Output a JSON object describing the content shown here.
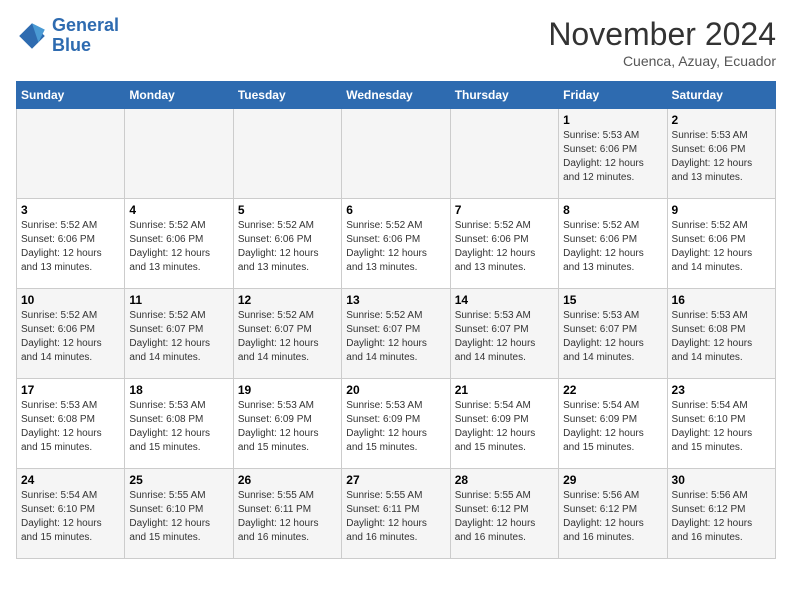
{
  "header": {
    "logo_line1": "General",
    "logo_line2": "Blue",
    "month": "November 2024",
    "location": "Cuenca, Azuay, Ecuador"
  },
  "days_of_week": [
    "Sunday",
    "Monday",
    "Tuesday",
    "Wednesday",
    "Thursday",
    "Friday",
    "Saturday"
  ],
  "weeks": [
    [
      {
        "day": "",
        "info": ""
      },
      {
        "day": "",
        "info": ""
      },
      {
        "day": "",
        "info": ""
      },
      {
        "day": "",
        "info": ""
      },
      {
        "day": "",
        "info": ""
      },
      {
        "day": "1",
        "info": "Sunrise: 5:53 AM\nSunset: 6:06 PM\nDaylight: 12 hours\nand 12 minutes."
      },
      {
        "day": "2",
        "info": "Sunrise: 5:53 AM\nSunset: 6:06 PM\nDaylight: 12 hours\nand 13 minutes."
      }
    ],
    [
      {
        "day": "3",
        "info": "Sunrise: 5:52 AM\nSunset: 6:06 PM\nDaylight: 12 hours\nand 13 minutes."
      },
      {
        "day": "4",
        "info": "Sunrise: 5:52 AM\nSunset: 6:06 PM\nDaylight: 12 hours\nand 13 minutes."
      },
      {
        "day": "5",
        "info": "Sunrise: 5:52 AM\nSunset: 6:06 PM\nDaylight: 12 hours\nand 13 minutes."
      },
      {
        "day": "6",
        "info": "Sunrise: 5:52 AM\nSunset: 6:06 PM\nDaylight: 12 hours\nand 13 minutes."
      },
      {
        "day": "7",
        "info": "Sunrise: 5:52 AM\nSunset: 6:06 PM\nDaylight: 12 hours\nand 13 minutes."
      },
      {
        "day": "8",
        "info": "Sunrise: 5:52 AM\nSunset: 6:06 PM\nDaylight: 12 hours\nand 13 minutes."
      },
      {
        "day": "9",
        "info": "Sunrise: 5:52 AM\nSunset: 6:06 PM\nDaylight: 12 hours\nand 14 minutes."
      }
    ],
    [
      {
        "day": "10",
        "info": "Sunrise: 5:52 AM\nSunset: 6:06 PM\nDaylight: 12 hours\nand 14 minutes."
      },
      {
        "day": "11",
        "info": "Sunrise: 5:52 AM\nSunset: 6:07 PM\nDaylight: 12 hours\nand 14 minutes."
      },
      {
        "day": "12",
        "info": "Sunrise: 5:52 AM\nSunset: 6:07 PM\nDaylight: 12 hours\nand 14 minutes."
      },
      {
        "day": "13",
        "info": "Sunrise: 5:52 AM\nSunset: 6:07 PM\nDaylight: 12 hours\nand 14 minutes."
      },
      {
        "day": "14",
        "info": "Sunrise: 5:53 AM\nSunset: 6:07 PM\nDaylight: 12 hours\nand 14 minutes."
      },
      {
        "day": "15",
        "info": "Sunrise: 5:53 AM\nSunset: 6:07 PM\nDaylight: 12 hours\nand 14 minutes."
      },
      {
        "day": "16",
        "info": "Sunrise: 5:53 AM\nSunset: 6:08 PM\nDaylight: 12 hours\nand 14 minutes."
      }
    ],
    [
      {
        "day": "17",
        "info": "Sunrise: 5:53 AM\nSunset: 6:08 PM\nDaylight: 12 hours\nand 15 minutes."
      },
      {
        "day": "18",
        "info": "Sunrise: 5:53 AM\nSunset: 6:08 PM\nDaylight: 12 hours\nand 15 minutes."
      },
      {
        "day": "19",
        "info": "Sunrise: 5:53 AM\nSunset: 6:09 PM\nDaylight: 12 hours\nand 15 minutes."
      },
      {
        "day": "20",
        "info": "Sunrise: 5:53 AM\nSunset: 6:09 PM\nDaylight: 12 hours\nand 15 minutes."
      },
      {
        "day": "21",
        "info": "Sunrise: 5:54 AM\nSunset: 6:09 PM\nDaylight: 12 hours\nand 15 minutes."
      },
      {
        "day": "22",
        "info": "Sunrise: 5:54 AM\nSunset: 6:09 PM\nDaylight: 12 hours\nand 15 minutes."
      },
      {
        "day": "23",
        "info": "Sunrise: 5:54 AM\nSunset: 6:10 PM\nDaylight: 12 hours\nand 15 minutes."
      }
    ],
    [
      {
        "day": "24",
        "info": "Sunrise: 5:54 AM\nSunset: 6:10 PM\nDaylight: 12 hours\nand 15 minutes."
      },
      {
        "day": "25",
        "info": "Sunrise: 5:55 AM\nSunset: 6:10 PM\nDaylight: 12 hours\nand 15 minutes."
      },
      {
        "day": "26",
        "info": "Sunrise: 5:55 AM\nSunset: 6:11 PM\nDaylight: 12 hours\nand 16 minutes."
      },
      {
        "day": "27",
        "info": "Sunrise: 5:55 AM\nSunset: 6:11 PM\nDaylight: 12 hours\nand 16 minutes."
      },
      {
        "day": "28",
        "info": "Sunrise: 5:55 AM\nSunset: 6:12 PM\nDaylight: 12 hours\nand 16 minutes."
      },
      {
        "day": "29",
        "info": "Sunrise: 5:56 AM\nSunset: 6:12 PM\nDaylight: 12 hours\nand 16 minutes."
      },
      {
        "day": "30",
        "info": "Sunrise: 5:56 AM\nSunset: 6:12 PM\nDaylight: 12 hours\nand 16 minutes."
      }
    ]
  ]
}
